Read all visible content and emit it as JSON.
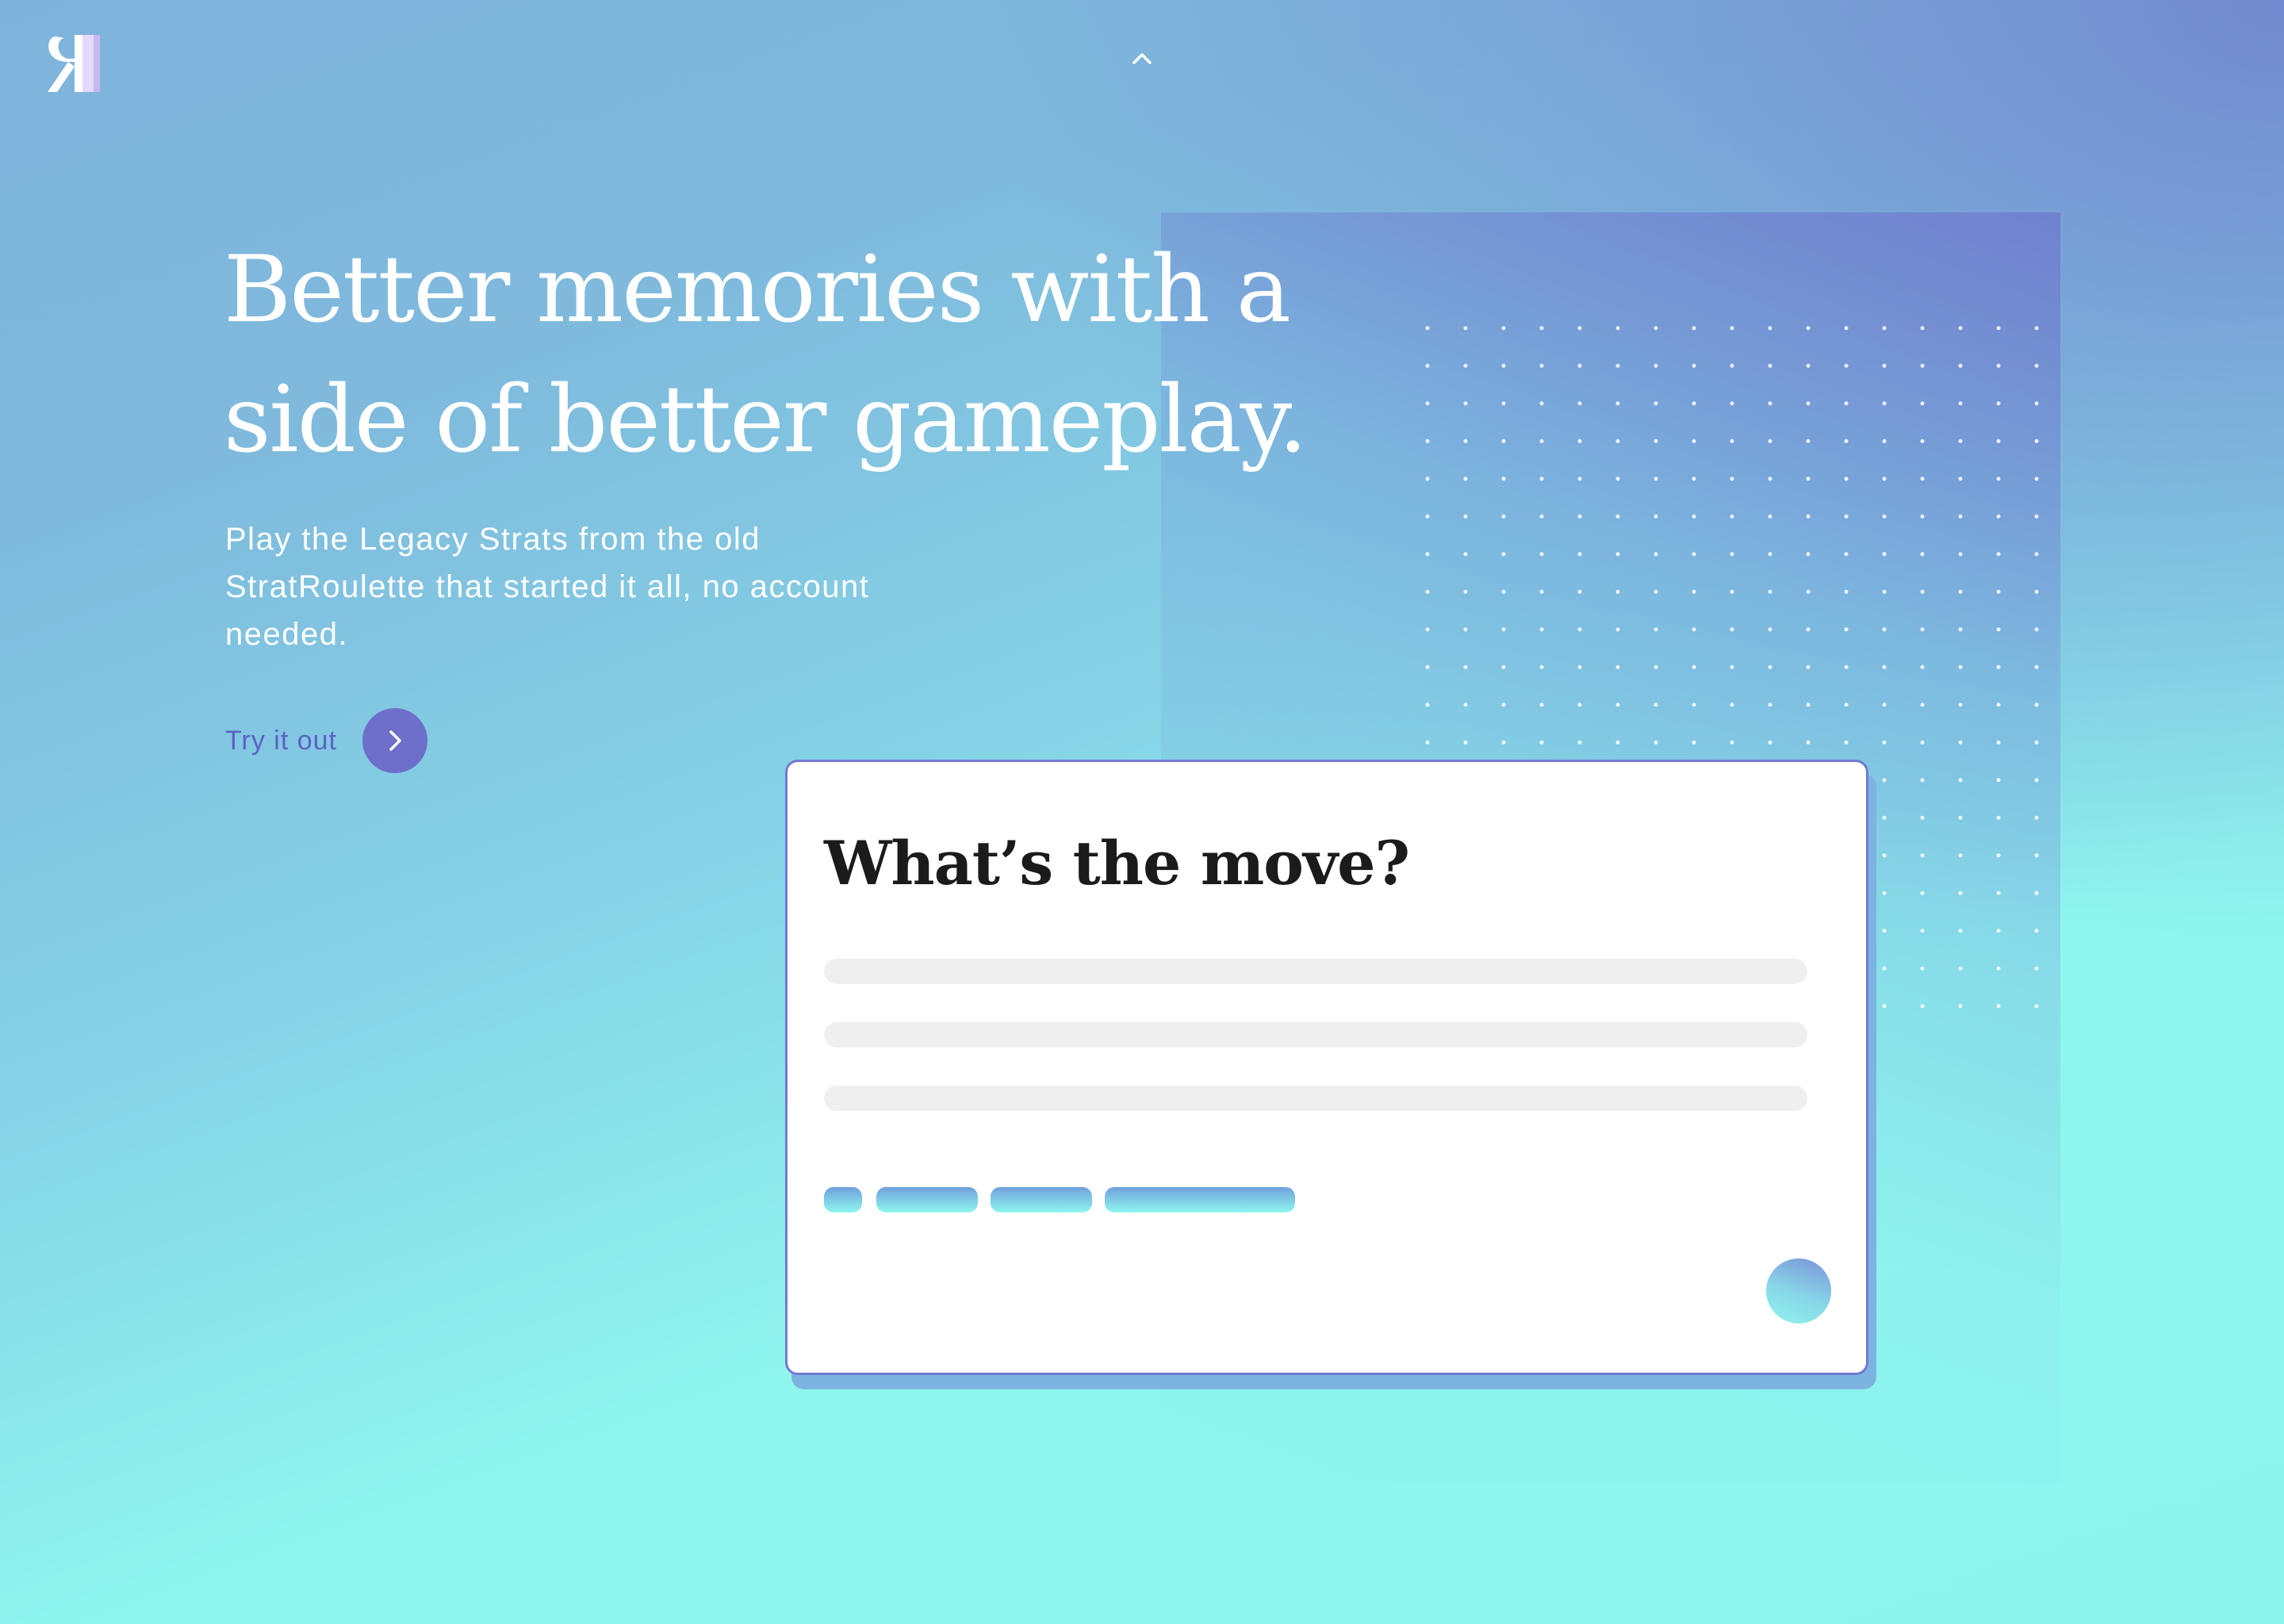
{
  "logo": {
    "icon": "sr-monogram-icon"
  },
  "nav": {
    "collapse_icon": "chevron-up-icon"
  },
  "hero": {
    "title": "Better memories with a side of better gameplay.",
    "subtitle": "Play the Legacy Strats from the old StratRoulette that started it all, no account needed.",
    "cta_label": "Try it out",
    "cta_icon": "chevron-right-icon"
  },
  "card": {
    "title": "What’s the move?",
    "placeholder_lines": 3,
    "tags": 4,
    "action_icon": "gradient-circle-icon"
  },
  "colors": {
    "background_start": "#7fb3dc",
    "background_end": "#8ff6ee",
    "accent": "#6d6fcb",
    "card_border": "#7379d1",
    "cta_text": "#5b63c4"
  }
}
